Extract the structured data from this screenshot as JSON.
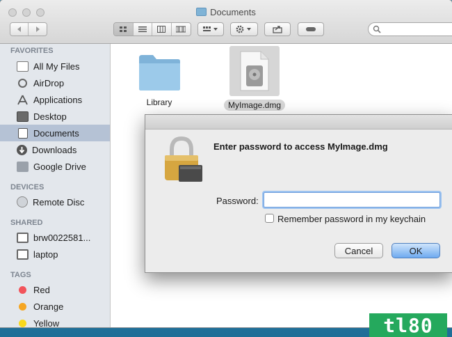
{
  "window": {
    "title": "Documents"
  },
  "toolbar": {
    "back_icon": "chevron-left-icon",
    "forward_icon": "chevron-right-icon",
    "view_modes": [
      "icon-view",
      "list-view",
      "column-view",
      "cover-flow-view"
    ],
    "arrange_icon": "arrange-icon",
    "action_icon": "gear-icon",
    "share_icon": "share-icon",
    "tag_icon": "tag-icon",
    "search_icon": "search-icon"
  },
  "sidebar": {
    "favorites_header": "FAVORITES",
    "favorites": [
      {
        "label": "All My Files",
        "icon": "all-files-icon"
      },
      {
        "label": "AirDrop",
        "icon": "airdrop-icon"
      },
      {
        "label": "Applications",
        "icon": "applications-icon"
      },
      {
        "label": "Desktop",
        "icon": "desktop-icon"
      },
      {
        "label": "Documents",
        "icon": "documents-icon",
        "selected": true
      },
      {
        "label": "Downloads",
        "icon": "downloads-icon"
      },
      {
        "label": "Google Drive",
        "icon": "folder-icon"
      }
    ],
    "devices_header": "DEVICES",
    "devices": [
      {
        "label": "Remote Disc",
        "icon": "disc-icon"
      }
    ],
    "shared_header": "SHARED",
    "shared": [
      {
        "label": "brw0022581...",
        "icon": "computer-icon"
      },
      {
        "label": "laptop",
        "icon": "computer-icon"
      }
    ],
    "tags_header": "TAGS",
    "tags": [
      {
        "label": "Red",
        "color": "#f2545b"
      },
      {
        "label": "Orange",
        "color": "#f5a623"
      },
      {
        "label": "Yellow",
        "color": "#f8d81c"
      }
    ]
  },
  "files": [
    {
      "name": "Library",
      "icon": "folder-icon"
    },
    {
      "name": "MyImage.dmg",
      "icon": "disk-image-icon",
      "selected": true
    }
  ],
  "dialog": {
    "message": "Enter password to access MyImage.dmg",
    "password_label": "Password:",
    "password_value": "",
    "remember_label": "Remember password in my keychain",
    "remember_checked": false,
    "cancel_label": "Cancel",
    "ok_label": "OK",
    "icon": "lock-icon"
  },
  "watermark": {
    "text": "tl80",
    "color": "#25a95d"
  }
}
